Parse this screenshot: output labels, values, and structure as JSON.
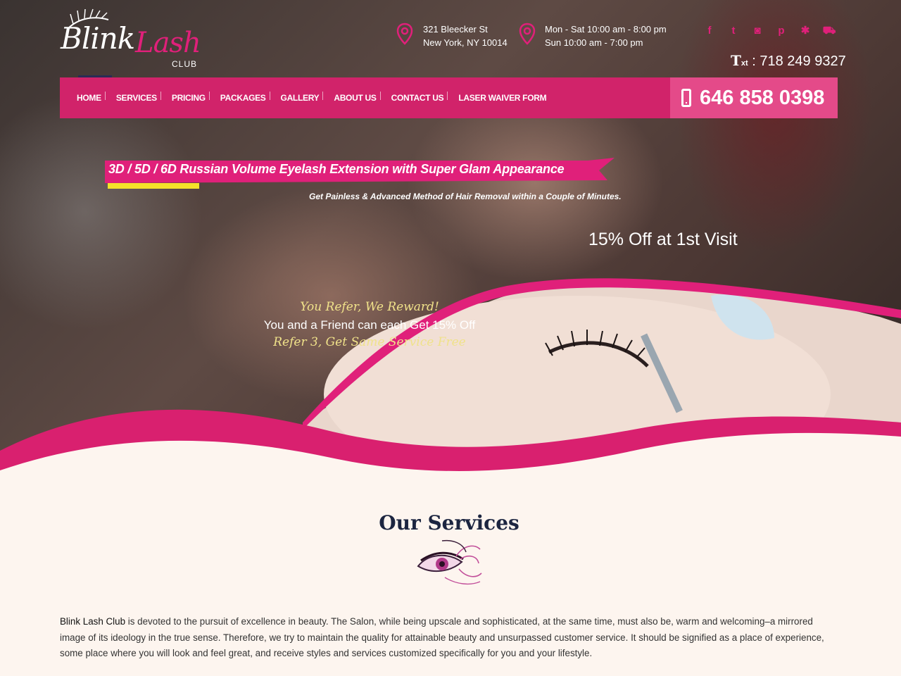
{
  "brand": {
    "logo_main": "Blink",
    "logo_accent": "Lash",
    "logo_sub": "CLUB"
  },
  "contact": {
    "address_line1": "321 Bleecker St",
    "address_line2": "New York, NY 10014",
    "hours_line1": "Mon - Sat 10:00 am - 8:00 pm",
    "hours_line2": "Sun 10:00 am - 7:00 pm",
    "text_prefix": "T",
    "text_suffix": "xt",
    "text_number": ": 718 249 9327",
    "phone": "646 858 0398"
  },
  "social": [
    {
      "icon": "facebook-icon",
      "glyph": "f"
    },
    {
      "icon": "twitter-icon",
      "glyph": "t"
    },
    {
      "icon": "instagram-icon",
      "glyph": "◙"
    },
    {
      "icon": "pinterest-icon",
      "glyph": "p"
    },
    {
      "icon": "yelp-icon",
      "glyph": "✱"
    },
    {
      "icon": "cart-icon",
      "glyph": "⛟"
    }
  ],
  "nav": {
    "items": [
      {
        "label": "HOME"
      },
      {
        "label": "SERVICES"
      },
      {
        "label": "PRICING"
      },
      {
        "label": "PACKAGES"
      },
      {
        "label": "GALLERY"
      },
      {
        "label": "ABOUT US"
      },
      {
        "label": "CONTACT US"
      },
      {
        "label": "LASER WAIVER FORM"
      }
    ]
  },
  "hero": {
    "banner": "3D / 5D / 6D Russian Volume Eyelash Extension with Super Glam Appearance",
    "subtext": "Get Painless & Advanced Method of Hair Removal within a Couple of Minutes.",
    "offer": "15% Off at 1st Visit",
    "refer_line1": "You Refer, We Reward!",
    "refer_line2": "You and a Friend can each Get 15% Off",
    "refer_line3": "Refer 3, Get Same Service Free"
  },
  "services": {
    "title": "Our Services",
    "about_bold": "Blink Lash Club",
    "about_text": " is devoted to the pursuit of excellence in beauty. The Salon, while being upscale and sophisticated, at the same time, must also be, warm and welcoming–a mirrored image of its ideology in the true sense. Therefore, we try to maintain the quality for attainable beauty and unsurpassed customer service. It should be signified as a place of experience, some place where you will look and feel great, and receive styles and services customized specifically for you and your lifestyle."
  },
  "colors": {
    "accent": "#d1236a",
    "accent_light": "#e44a89",
    "background": "#fdf5ef",
    "heading": "#1c2540"
  }
}
